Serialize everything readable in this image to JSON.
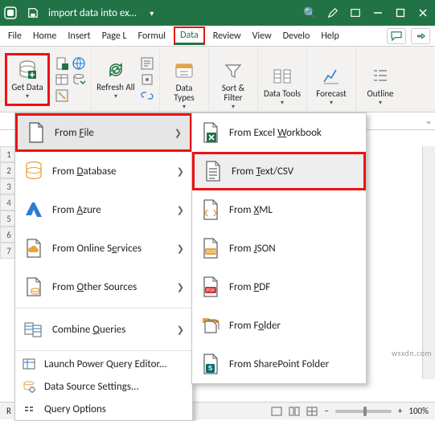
{
  "titlebar": {
    "doc_name": "import data into ex…",
    "search_glyph": "🔍",
    "menu_dots": "⋯"
  },
  "tabs": {
    "items": [
      "File",
      "Home",
      "Insert",
      "Page L",
      "Formul",
      "Data",
      "Review",
      "View",
      "Develo",
      "Help"
    ],
    "active_index": 5
  },
  "ribbon": {
    "get_data": "Get Data",
    "refresh_all": "Refresh All",
    "data_types": "Data Types",
    "sort_filter": "Sort & Filter",
    "data_tools": "Data Tools",
    "forecast": "Forecast",
    "outline": "Outline"
  },
  "menu1": {
    "from_file": "From File",
    "from_database": "From Database",
    "from_azure": "From Azure",
    "from_online": "From Online Services",
    "from_other": "From Other Sources",
    "combine": "Combine Queries",
    "launch_pq": "Launch Power Query Editor...",
    "ds_settings": "Data Source Settings...",
    "q_options": "Query Options"
  },
  "menu2": {
    "from_workbook": "From Excel Workbook",
    "from_text": "From Text/CSV",
    "from_xml": "From XML",
    "from_json": "From JSON",
    "from_pdf": "From PDF",
    "from_folder": "From Folder",
    "from_sp": "From SharePoint Folder"
  },
  "status": {
    "left": "R",
    "zoom": "100%"
  },
  "watermark": "wsxdn.com"
}
